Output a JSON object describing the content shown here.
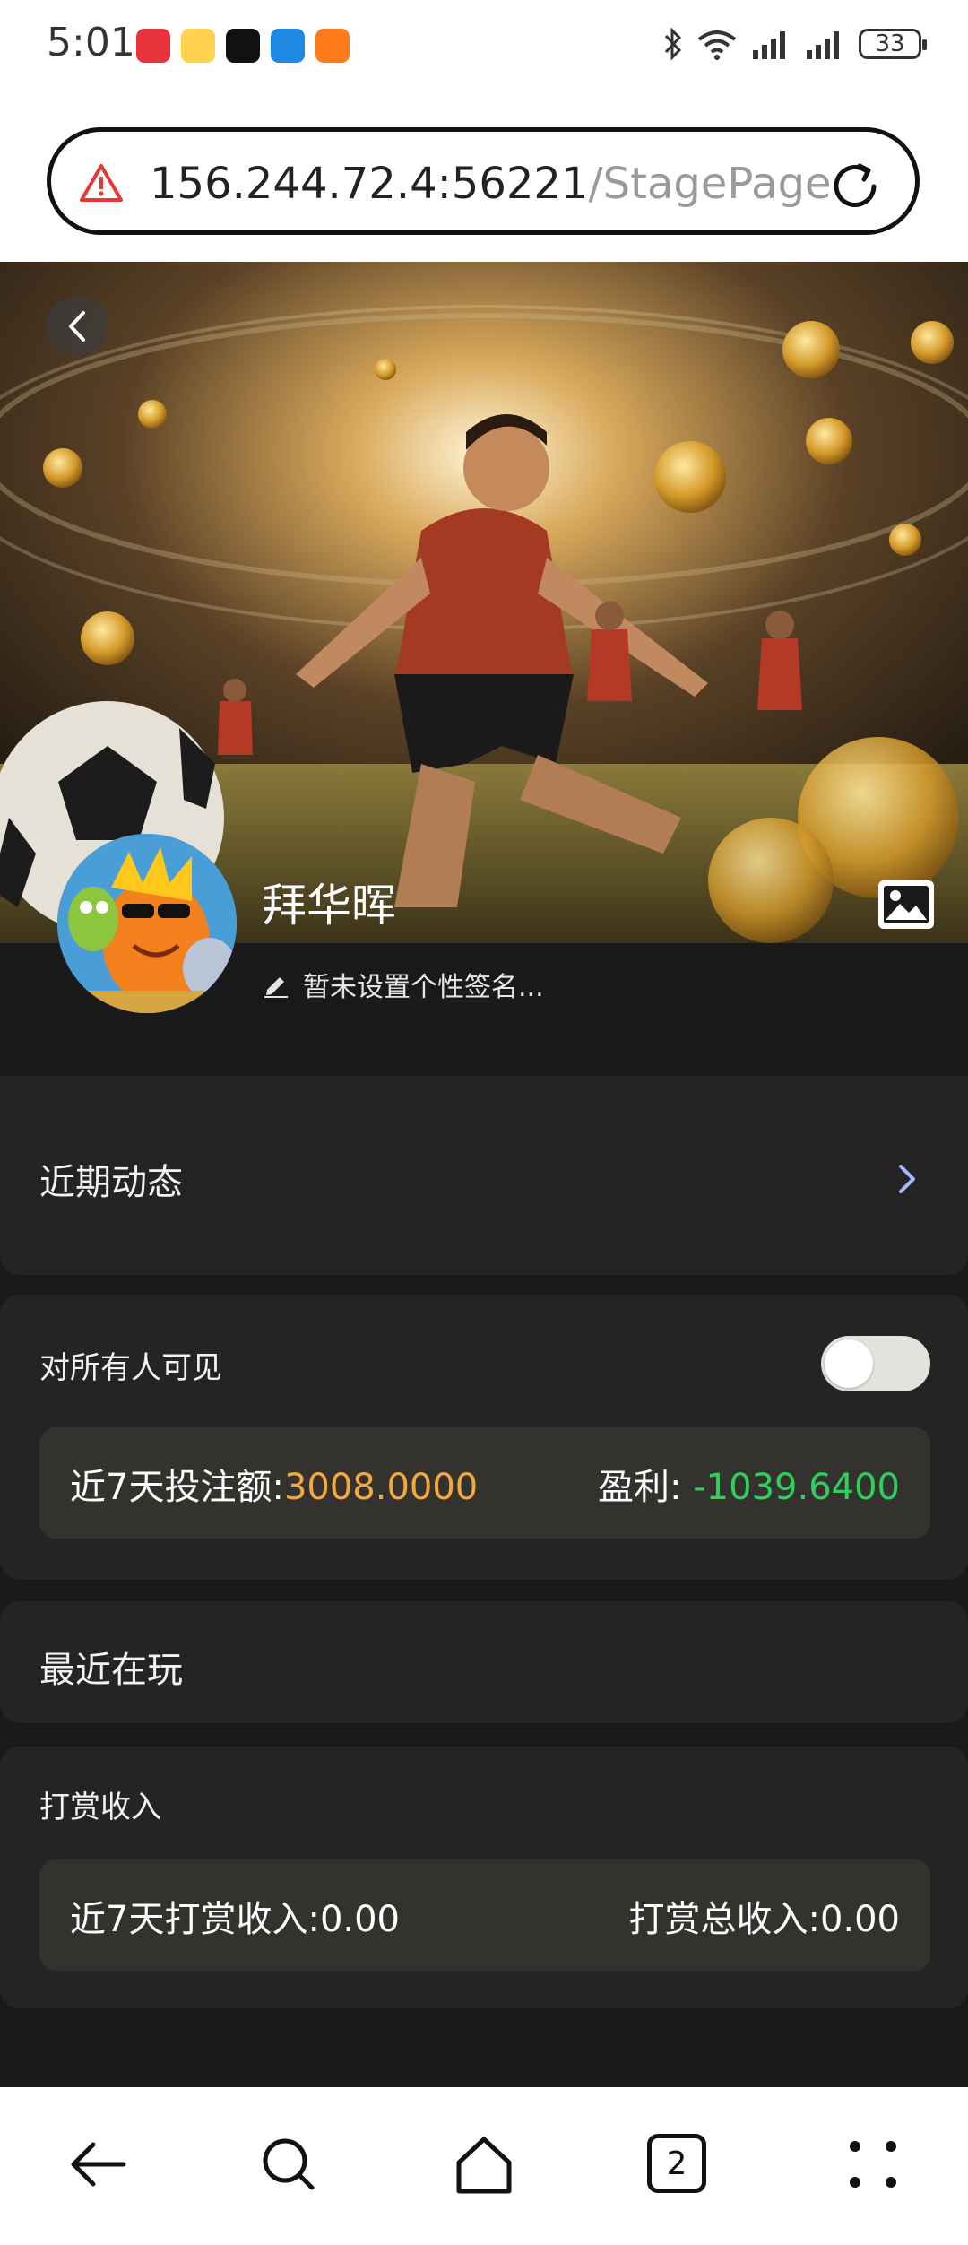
{
  "status_bar": {
    "time": "5:01",
    "battery": "33"
  },
  "browser": {
    "url_host": "156.244.72.4:56221",
    "url_path": "/StagePage",
    "tab_count": "2"
  },
  "profile": {
    "username": "拜华晖",
    "signature": "暂未设置个性签名..."
  },
  "sections": {
    "recent_activity": "近期动态",
    "visibility_label": "对所有人可见",
    "visibility_on": false,
    "bet_label": "近7天投注额:",
    "bet_value": "3008.0000",
    "profit_label": "盈利:",
    "profit_value": "-1039.6400",
    "recently_playing": "最近在玩",
    "tips_title": "打赏收入",
    "tips_7d_label": "近7天打赏收入:",
    "tips_7d_value": "0.00",
    "tips_total_label": "打赏总收入:",
    "tips_total_value": "0.00"
  },
  "colors": {
    "accent_orange": "#f4a93c",
    "profit_green": "#2ed05b",
    "card_bg": "#242424"
  }
}
